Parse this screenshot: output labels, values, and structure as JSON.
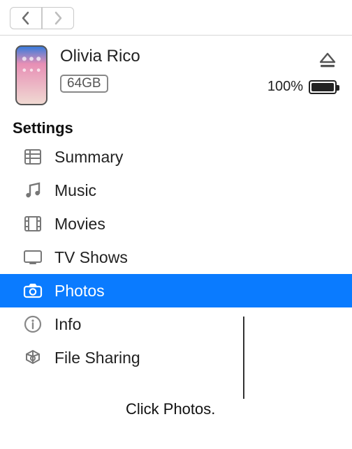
{
  "device": {
    "name": "Olivia Rico",
    "capacity": "64GB",
    "battery_label": "100%"
  },
  "section_label": "Settings",
  "items": [
    {
      "label": "Summary",
      "icon": "summary-icon",
      "selected": false
    },
    {
      "label": "Music",
      "icon": "music-icon",
      "selected": false
    },
    {
      "label": "Movies",
      "icon": "movies-icon",
      "selected": false
    },
    {
      "label": "TV Shows",
      "icon": "tvshows-icon",
      "selected": false
    },
    {
      "label": "Photos",
      "icon": "photos-icon",
      "selected": true
    },
    {
      "label": "Info",
      "icon": "info-icon",
      "selected": false
    },
    {
      "label": "File Sharing",
      "icon": "filesharing-icon",
      "selected": false
    }
  ],
  "callout": "Click Photos."
}
